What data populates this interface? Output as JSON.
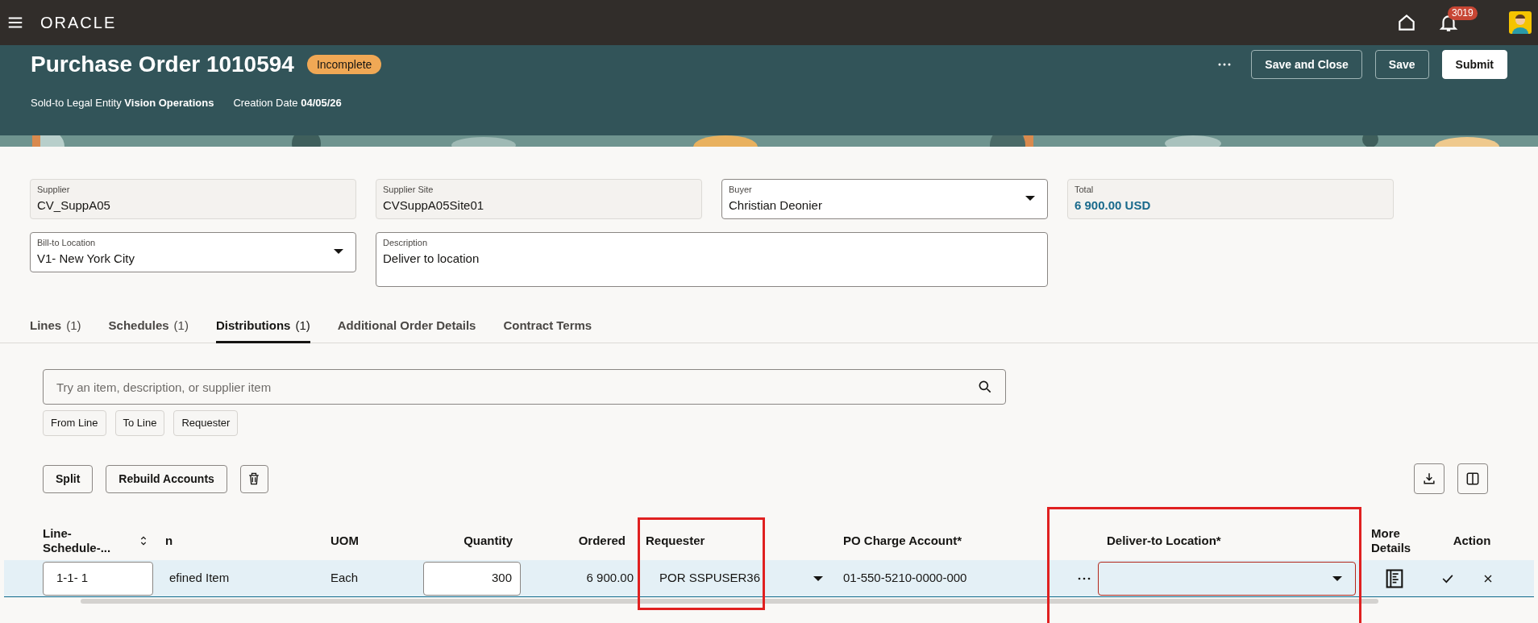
{
  "top_bar": {
    "logo": "ORACLE",
    "notification_count": "3019"
  },
  "header": {
    "title": "Purchase Order 1010594",
    "status": "Incomplete",
    "meta": [
      "Sold-to Legal Entity **Vision Operations**",
      "Creation Date **04/05/26**"
    ],
    "actions": [
      {
        "label": "Save and Close",
        "kind": "outline"
      },
      {
        "label": "Save",
        "kind": "outline"
      },
      {
        "label": "Submit",
        "kind": "primary"
      }
    ]
  },
  "fields": [
    {
      "label": "Supplier",
      "value": "CV_SuppA05",
      "kind": "readonly"
    },
    {
      "label": "Supplier Site",
      "value": "CVSuppA05Site01",
      "kind": "readonly"
    },
    {
      "label": "Buyer",
      "value": "Christian Deonier",
      "kind": "select"
    },
    {
      "label": "Total",
      "value": "6 900.00 USD",
      "kind": "total"
    },
    {
      "label": "Bill-to Location",
      "value": "V1- New York City",
      "kind": "select"
    },
    {
      "label": "Description",
      "value": "Deliver to location",
      "kind": "textarea"
    }
  ],
  "tabs": [
    {
      "label": "Lines",
      "count": "(1)",
      "selected": false
    },
    {
      "label": "Schedules",
      "count": "(1)",
      "selected": false
    },
    {
      "label": "Distributions",
      "count": "(1)",
      "selected": true
    },
    {
      "label": "Additional Order Details",
      "selected": false
    },
    {
      "label": "Contract Terms",
      "selected": false
    }
  ],
  "search": {
    "placeholder": "Try an item, description, or supplier item"
  },
  "filters": [
    "From Line",
    "To Line",
    "Requester"
  ],
  "toolbar": [
    "Split",
    "Rebuild Accounts"
  ],
  "table": {
    "columns": [
      {
        "label": "Line-Schedule-...",
        "highlighted": false
      },
      {
        "label": "n",
        "highlighted": false
      },
      {
        "label": "UOM",
        "highlighted": false
      },
      {
        "label": "Quantity",
        "highlighted": false
      },
      {
        "label": "Ordered",
        "highlighted": false
      },
      {
        "label": "Requester",
        "highlighted": true
      },
      {
        "label": "PO Charge Account*",
        "highlighted": false
      },
      {
        "label": "Deliver-to Location*",
        "highlighted": true
      },
      {
        "label": "More Details",
        "highlighted": false
      },
      {
        "label": "Action",
        "highlighted": false
      }
    ],
    "rows": [
      {
        "selected": true,
        "cells": [
          {
            "kind": "input",
            "value": "1-1- 1"
          },
          {
            "kind": "text",
            "value": "efined Item"
          },
          {
            "kind": "text",
            "value": "Each"
          },
          {
            "kind": "number_input",
            "value": "300"
          },
          {
            "kind": "number",
            "value": "6 900.00"
          },
          {
            "kind": "select",
            "value": "POR SSPUSER36"
          },
          {
            "kind": "text",
            "value": "01-550-5210-0000-000"
          },
          {
            "kind": "lov",
            "invalid": true
          },
          {
            "kind": "details"
          },
          {
            "kind": "actions"
          }
        ]
      }
    ]
  }
}
